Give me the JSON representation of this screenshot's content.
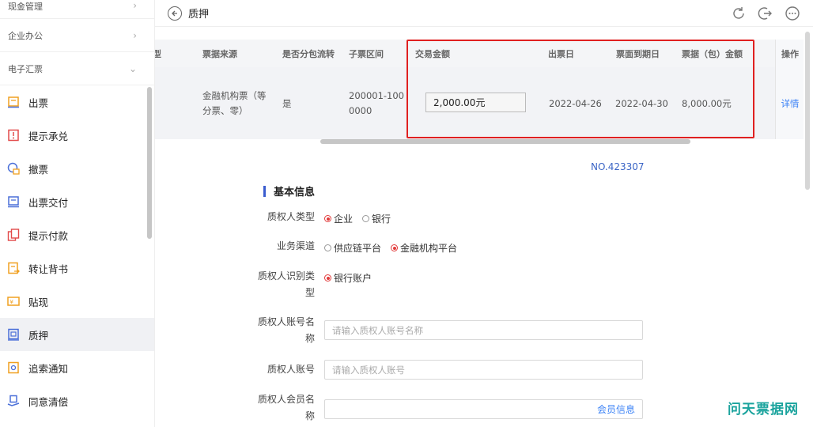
{
  "sidebar": {
    "groups": [
      {
        "label": "现金管理",
        "icon": "chevron-right-icon"
      },
      {
        "label": "企业办公",
        "icon": "chevron-right-icon"
      },
      {
        "label": "电子汇票",
        "icon": "chevron-down-icon"
      }
    ],
    "items": [
      {
        "label": "出票",
        "icon": "bill-icon"
      },
      {
        "label": "提示承兑",
        "icon": "accept-icon"
      },
      {
        "label": "撤票",
        "icon": "revoke-icon"
      },
      {
        "label": "出票交付",
        "icon": "deliver-icon"
      },
      {
        "label": "提示付款",
        "icon": "payment-icon"
      },
      {
        "label": "转让背书",
        "icon": "endorse-icon"
      },
      {
        "label": "贴现",
        "icon": "discount-icon"
      },
      {
        "label": "质押",
        "icon": "pledge-icon",
        "active": true
      },
      {
        "label": "追索通知",
        "icon": "recourse-icon"
      },
      {
        "label": "同意清偿",
        "icon": "settle-icon"
      }
    ]
  },
  "header": {
    "title": "质押",
    "actions": [
      "refresh-icon",
      "logout-icon",
      "more-icon"
    ]
  },
  "table": {
    "columns": [
      "类型",
      "票据来源",
      "是否分包流转",
      "子票区间",
      "交易金额",
      "出票日",
      "票面到期日",
      "票据（包）金额",
      "操作"
    ],
    "row": {
      "source": "金融机构票（等分票、零）",
      "split": "是",
      "range": "200001-1000000",
      "amount": "2,000.00元",
      "issue_date": "2022-04-26",
      "due_date": "2022-04-30",
      "bill_amount": "8,000.00元",
      "action": "详情"
    }
  },
  "form": {
    "doc_no": "NO.423307",
    "section_title": "基本信息",
    "pledgee_type": {
      "label": "质权人类型",
      "options": [
        "企业",
        "银行"
      ],
      "selected": "企业"
    },
    "channel": {
      "label": "业务渠道",
      "options": [
        "供应链平台",
        "金融机构平台"
      ],
      "selected": "金融机构平台"
    },
    "id_type": {
      "label": "质权人识别类型",
      "options": [
        "银行账户"
      ],
      "selected": "银行账户"
    },
    "account_name": {
      "label": "质权人账号名称",
      "placeholder": "请输入质权人账号名称"
    },
    "account_no": {
      "label": "质权人账号",
      "placeholder": "请输入质权人账号"
    },
    "member_name": {
      "label": "质权人会员名称",
      "link": "会员信息"
    }
  },
  "watermark": "问天票据网",
  "colors": {
    "accent": "#3b82f6",
    "highlight": "#e02020",
    "radio_on": "#e23b3b",
    "brand": "#1aa39d"
  }
}
